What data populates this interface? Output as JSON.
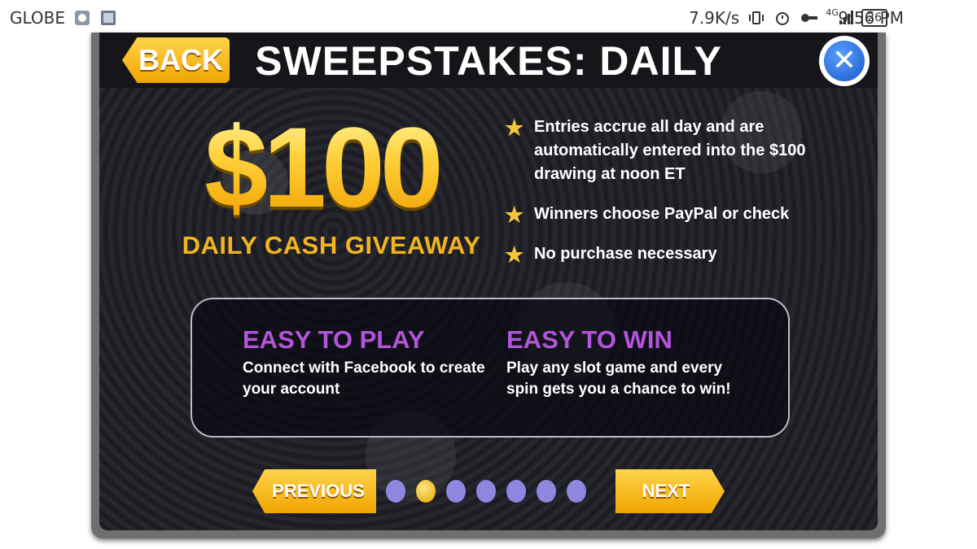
{
  "status_bar": {
    "carrier": "GLOBE",
    "speed": "7.9K/s",
    "network": "4G",
    "battery": "26",
    "time": "9:56 PM"
  },
  "header": {
    "title": "SWEEPSTAKES: DAILY",
    "back_label": "BACK",
    "close_icon": "close-x-icon"
  },
  "prize": {
    "amount": "$100",
    "subtitle": "DAILY CASH GIVEAWAY"
  },
  "bullets": [
    "Entries accrue all day and are automatically entered into the $100 drawing at noon ET",
    "Winners choose PayPal or check",
    "No purchase necessary"
  ],
  "info": {
    "play_title": "EASY TO PLAY",
    "play_text": "Connect with Facebook to create your account",
    "win_title": "EASY TO WIN",
    "win_text": "Play any slot game and every spin gets you a chance to win!"
  },
  "navigation": {
    "previous_label": "PREVIOUS",
    "next_label": "NEXT",
    "page_count": 7,
    "active_page": 2
  },
  "colors": {
    "gold": "#ffc21a",
    "purple_heading": "#b255d9",
    "dot": "#8f86e0"
  }
}
